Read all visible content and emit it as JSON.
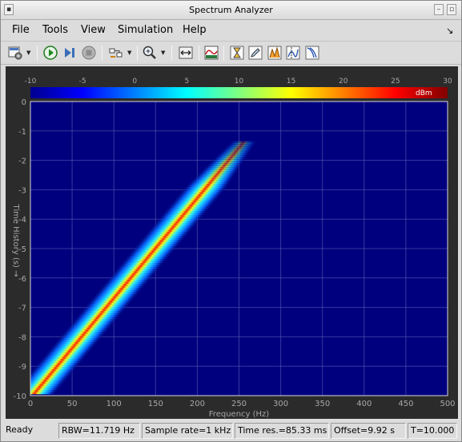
{
  "window": {
    "title": "Spectrum Analyzer"
  },
  "menu": {
    "items": [
      {
        "name": "menu-file",
        "label": "File"
      },
      {
        "name": "menu-tools",
        "label": "Tools"
      },
      {
        "name": "menu-view",
        "label": "View"
      },
      {
        "name": "menu-simulation",
        "label": "Simulation"
      },
      {
        "name": "menu-help",
        "label": "Help"
      }
    ],
    "dock_icon": "dock-arrow-icon"
  },
  "toolbar": {
    "icons": [
      "settings-icon",
      "run-icon",
      "step-forward-icon",
      "stop-icon",
      "signal-select-icon",
      "zoom-icon",
      "autoscale-icon",
      "spectrum-mode-icon",
      "trigger-icon",
      "edit-icon",
      "peak-finder-icon",
      "cursor-measurements-icon",
      "distortion-icon"
    ]
  },
  "colorbar": {
    "ticks": [
      "-10",
      "-5",
      "0",
      "5",
      "10",
      "15",
      "20",
      "25",
      "30"
    ],
    "unit": "dBm"
  },
  "chart_data": {
    "type": "heatmap",
    "title": "",
    "xlabel": "Frequency (Hz)",
    "ylabel": "Time History (s) →",
    "x_ticks": [
      "0",
      "50",
      "100",
      "150",
      "200",
      "250",
      "300",
      "350",
      "400",
      "450",
      "500"
    ],
    "y_ticks": [
      "0",
      "-1",
      "-2",
      "-3",
      "-4",
      "-5",
      "-6",
      "-7",
      "-8",
      "-9",
      "-10"
    ],
    "xlim": [
      0,
      500
    ],
    "ylim": [
      -10,
      0
    ],
    "clim": [
      -10,
      30
    ],
    "color_unit": "dBm",
    "colormap": "jet",
    "grid": true,
    "background_color": "#00007f",
    "chirp_ridge": [
      {
        "time_s": -9.9,
        "freq_hz": 5
      },
      {
        "time_s": -1.4,
        "freq_hz": 255
      }
    ],
    "ridge_peak_dbm": 25
  },
  "status": {
    "ready": "Ready",
    "rbw": "RBW=11.719 Hz",
    "sample_rate": "Sample rate=1 kHz",
    "time_res": "Time res.=85.33 ms",
    "offset": "Offset=9.92 s",
    "t": "T=10.000"
  }
}
